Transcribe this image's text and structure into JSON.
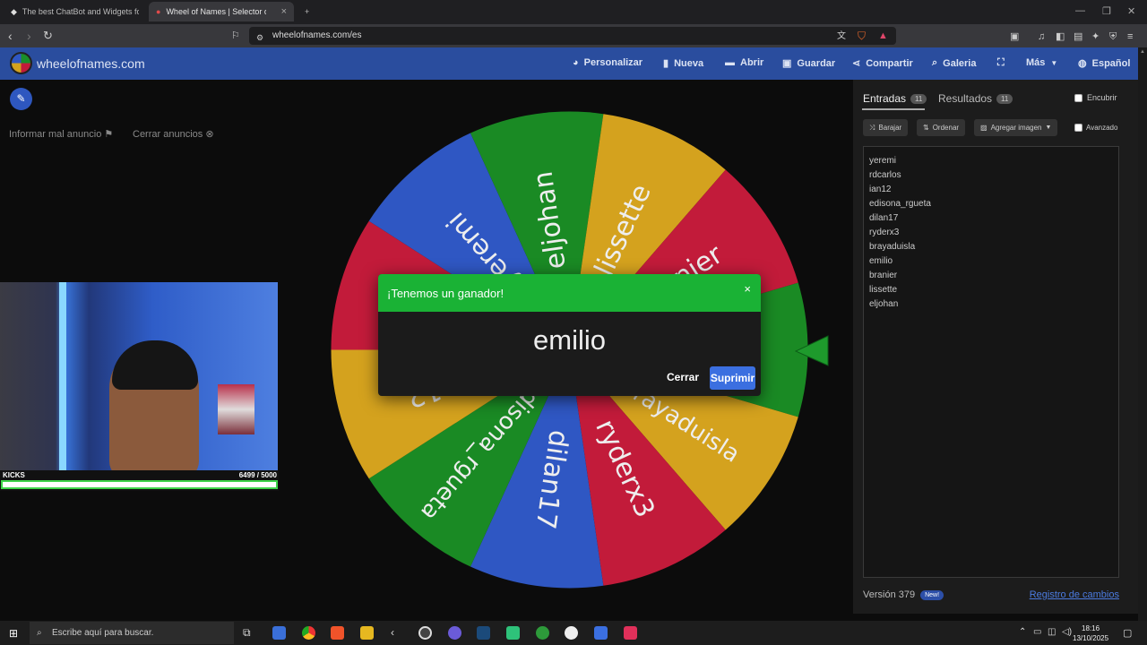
{
  "browser": {
    "tabs": [
      {
        "title": "The best ChatBot and Widgets for Ki"
      },
      {
        "title": "Wheel of Names | Selector de no"
      }
    ],
    "url": "wheelofnames.com/es"
  },
  "site": {
    "name": "wheelofnames.com",
    "menu": [
      {
        "label": "Personalizar",
        "icon": "palette-icon"
      },
      {
        "label": "Nueva",
        "icon": "file-icon"
      },
      {
        "label": "Abrir",
        "icon": "folder-icon"
      },
      {
        "label": "Guardar",
        "icon": "save-icon"
      },
      {
        "label": "Compartir",
        "icon": "share-icon"
      },
      {
        "label": "Galeria",
        "icon": "search-icon"
      },
      {
        "label": "",
        "icon": "fullscreen-icon"
      },
      {
        "label": "Más",
        "icon": "chevron-down-icon"
      },
      {
        "label": "Español",
        "icon": "globe-icon"
      }
    ]
  },
  "left": {
    "report_ad": "Informar mal anuncio",
    "close_ads": "Cerrar anuncios"
  },
  "webcam": {
    "label": "KICKS",
    "value": "6499  / 5000",
    "progress": 1.0
  },
  "wheel": {
    "colors": [
      "#1a8a24",
      "#d4a21e",
      "#c21b3a",
      "#2f57c3"
    ],
    "segments": [
      "emilio",
      "brayaduisla",
      "ryderx3",
      "dilan17",
      "edisona_rgueta",
      "ian12",
      "rdcarlos",
      "yeremi",
      "eljohan",
      "lissette",
      "branier"
    ]
  },
  "modal": {
    "title": "¡Tenemos un ganador!",
    "winner": "emilio",
    "close_label": "Cerrar",
    "remove_label": "Suprimir"
  },
  "panel": {
    "tab_entries": "Entradas",
    "entries_count": "11",
    "tab_results": "Resultados",
    "results_count": "11",
    "hide_label": "Encubrir",
    "shuffle_label": "Barajar",
    "sort_label": "Ordenar",
    "add_image_label": "Agregar imagen",
    "advanced_label": "Avanzado",
    "entries": [
      "yeremi",
      "rdcarlos",
      "ian12",
      "edisona_rgueta",
      "dilan17",
      "ryderx3",
      "brayaduisla",
      "emilio",
      "branier",
      "lissette",
      "eljohan"
    ],
    "version": "Versión 379",
    "new_badge": "New!",
    "changelog": "Registro de cambios"
  },
  "taskbar": {
    "search_placeholder": "Escribe aquí para buscar.",
    "time": "18:16",
    "date": "13/10/2025"
  }
}
